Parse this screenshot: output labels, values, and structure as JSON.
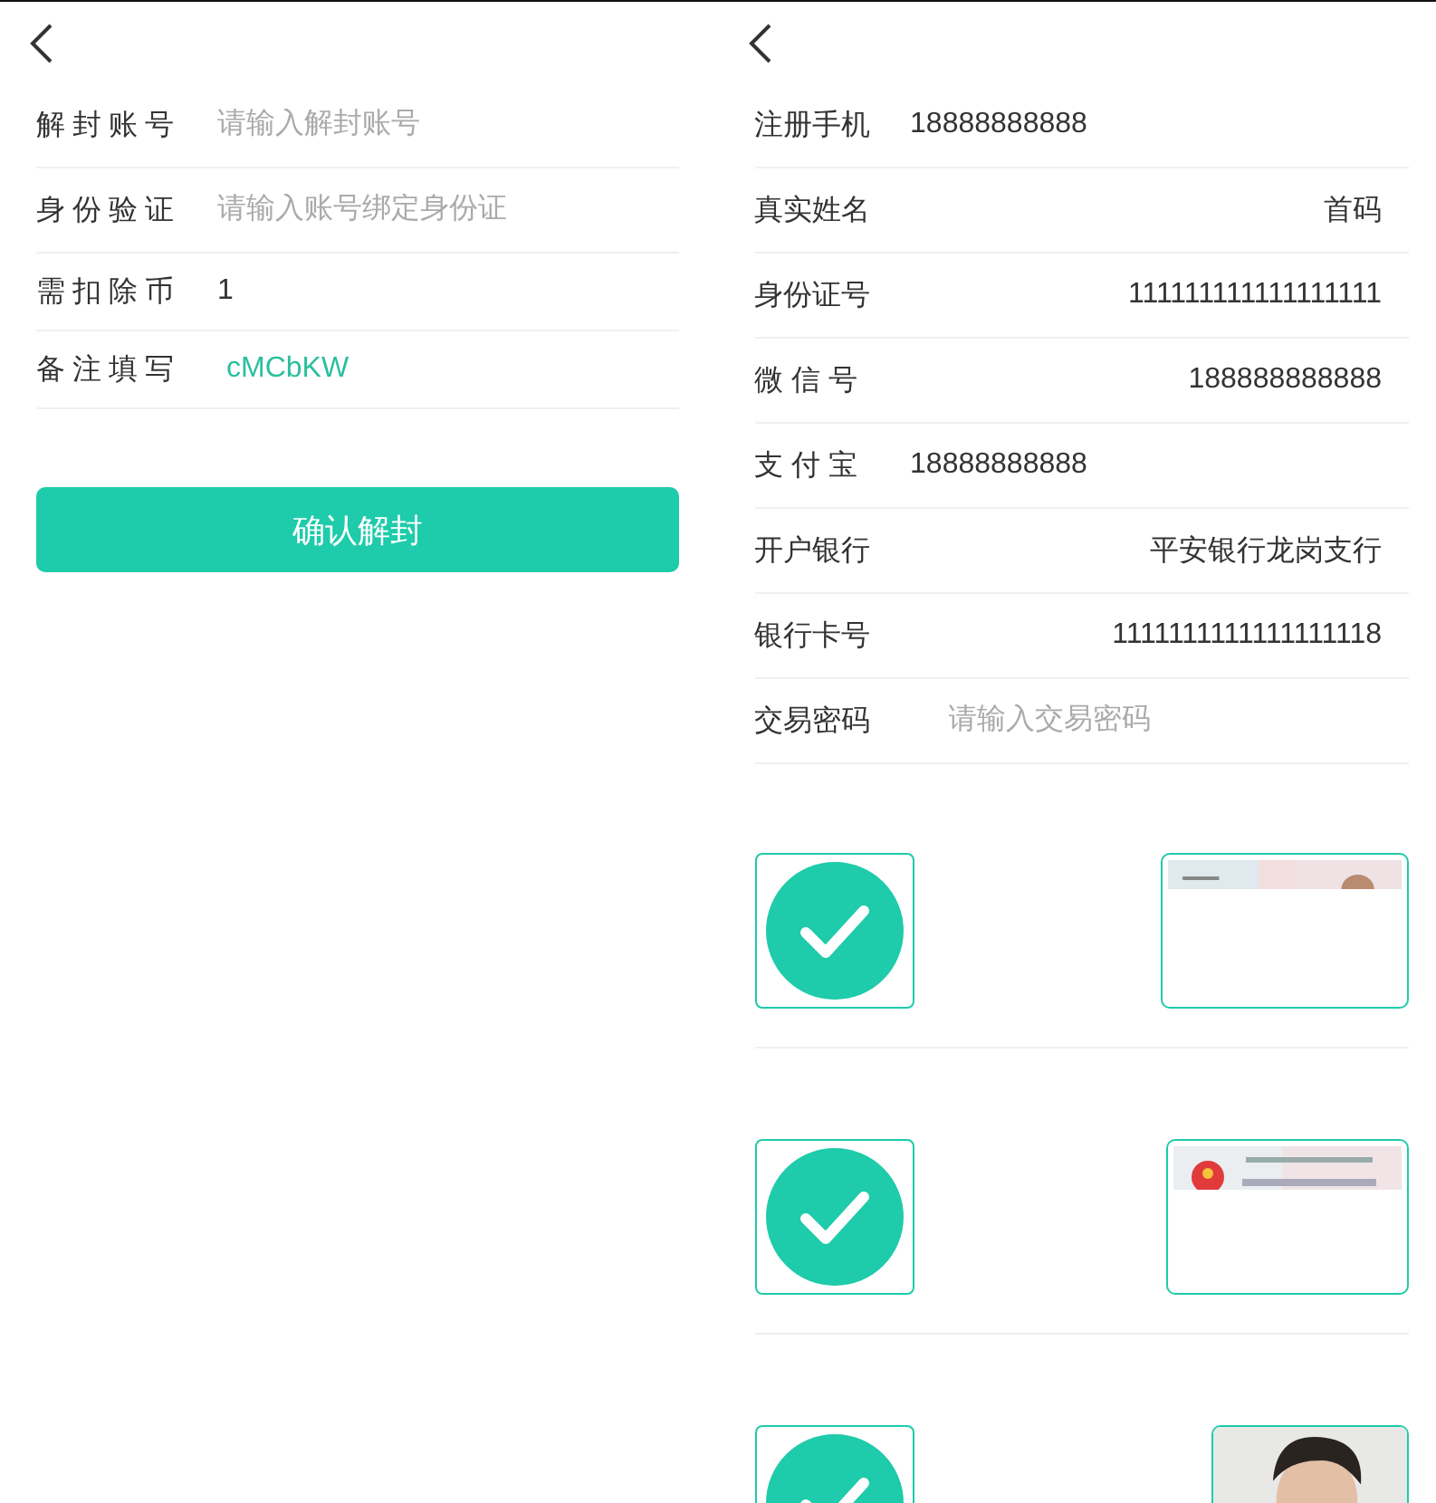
{
  "left_panel": {
    "fields": [
      {
        "label": "解封账号",
        "placeholder": "请输入解封账号",
        "kind": "input"
      },
      {
        "label": "身份验证",
        "placeholder": "请输入账号绑定身份证",
        "kind": "input"
      },
      {
        "label": "需扣除币",
        "value": "1",
        "kind": "input"
      },
      {
        "label": "备注填写",
        "value": "cMCbKW",
        "kind": "code"
      }
    ],
    "button": "确认解封"
  },
  "right_panel": {
    "fields": [
      {
        "label": "注册手机",
        "value": "18888888888",
        "kind": "left"
      },
      {
        "label": "真实姓名",
        "value": "首码",
        "kind": "right"
      },
      {
        "label": "身份证号",
        "value": "111111111111111111",
        "kind": "right"
      },
      {
        "label": "微 信 号",
        "value": "188888888888",
        "kind": "right"
      },
      {
        "label": "支 付 宝",
        "value": "18888888888",
        "kind": "left"
      },
      {
        "label": "开户银行",
        "value": "平安银行龙岗支行",
        "kind": "right"
      },
      {
        "label": "银行卡号",
        "value": "1111111111111111118",
        "kind": "right"
      },
      {
        "label": "交易密码",
        "placeholder": "请输入交易密码",
        "kind": "input"
      }
    ],
    "uploads": [
      {
        "kind": "card",
        "verified": true
      },
      {
        "kind": "emblem-card",
        "verified": true
      },
      {
        "kind": "portrait",
        "verified": true
      }
    ]
  }
}
